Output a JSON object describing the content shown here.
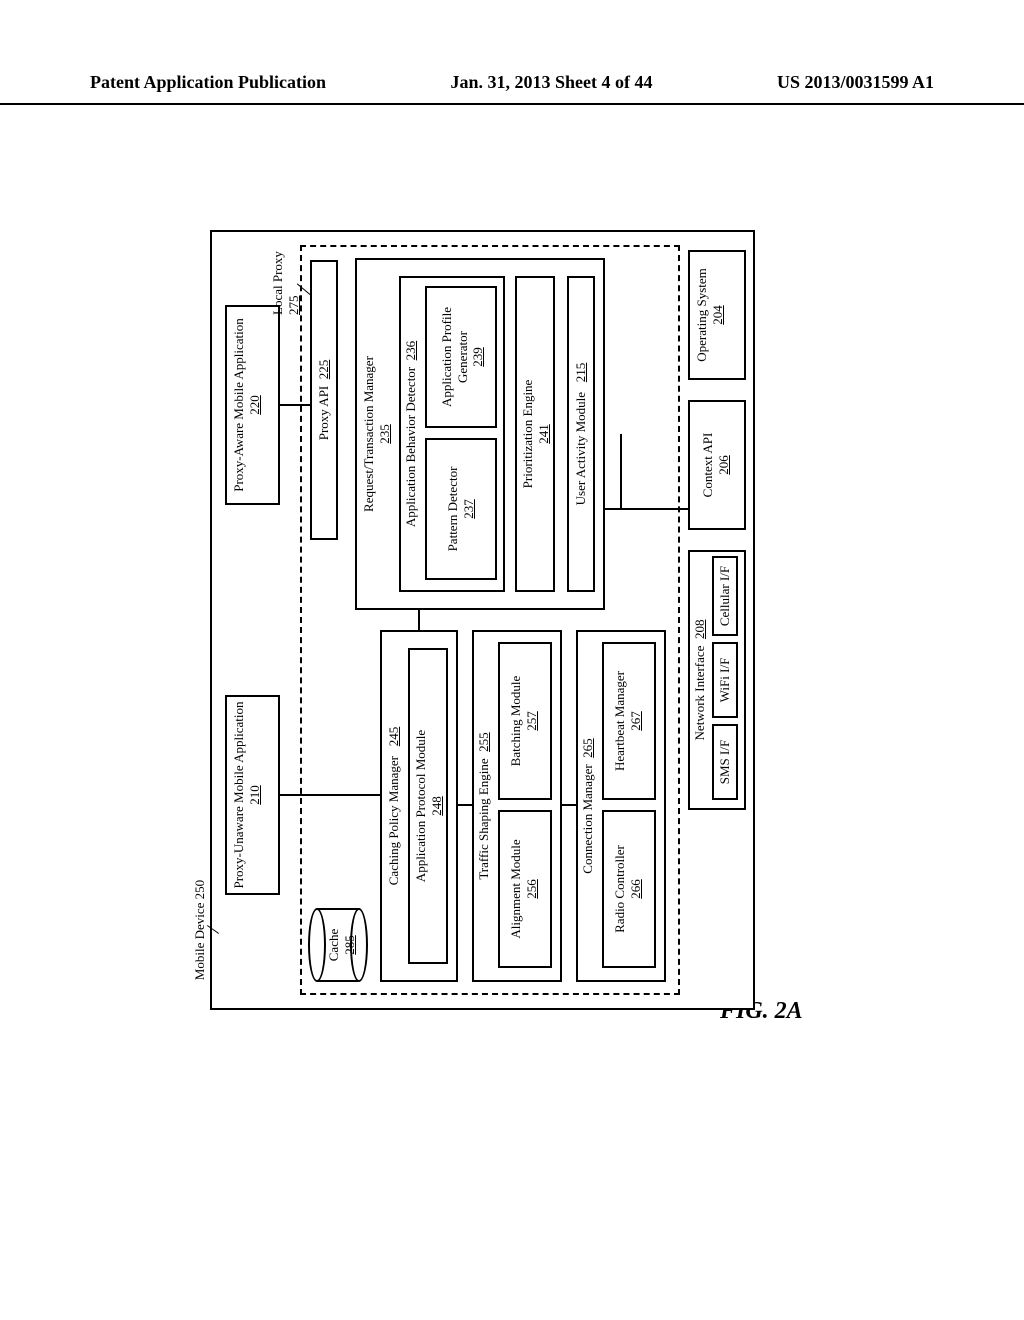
{
  "header": {
    "left": "Patent Application Publication",
    "center": "Jan. 31, 2013  Sheet 4 of 44",
    "right": "US 2013/0031599 A1"
  },
  "fig_caption": "FIG. 2A",
  "labels": {
    "mobile_device": "Mobile Device 250",
    "local_proxy": "Local Proxy",
    "local_proxy_ref": "275"
  },
  "boxes": {
    "proxy_unaware": {
      "title": "Proxy-Unaware Mobile Application",
      "ref": "210"
    },
    "proxy_aware": {
      "title": "Proxy-Aware Mobile Application",
      "ref": "220"
    },
    "cache": {
      "title": "Cache",
      "ref": "285"
    },
    "proxy_api": {
      "title": "Proxy API",
      "ref": "225"
    },
    "cpm": {
      "title": "Caching Policy Manager",
      "ref": "245"
    },
    "apm": {
      "title": "Application Protocol Module",
      "ref": "248"
    },
    "rtm": {
      "title": "Request/Transaction Manager",
      "ref": "235"
    },
    "abd": {
      "title": "Application Behavior Detector",
      "ref": "236"
    },
    "pattern": {
      "title": "Pattern Detector",
      "ref": "237"
    },
    "approf": {
      "title": "Application Profile Generator",
      "ref": "239"
    },
    "prio": {
      "title": "Prioritization Engine",
      "ref": "241"
    },
    "tse": {
      "title": "Traffic Shaping Engine",
      "ref": "255"
    },
    "align": {
      "title": "Alignment Module",
      "ref": "256"
    },
    "batch": {
      "title": "Batching Module",
      "ref": "257"
    },
    "cm": {
      "title": "Connection Manager",
      "ref": "265"
    },
    "radio": {
      "title": "Radio Controller",
      "ref": "266"
    },
    "hb": {
      "title": "Heartbeat Manager",
      "ref": "267"
    },
    "uam": {
      "title": "User Activity Module",
      "ref": "215"
    },
    "ni": {
      "title": "Network Interface",
      "ref": "208"
    },
    "sms": {
      "title": "SMS I/F"
    },
    "wifi": {
      "title": "WiFi I/F"
    },
    "cell": {
      "title": "Cellular I/F"
    },
    "ctx": {
      "title": "Context API",
      "ref": "206"
    },
    "os": {
      "title": "Operating System",
      "ref": "204"
    }
  }
}
